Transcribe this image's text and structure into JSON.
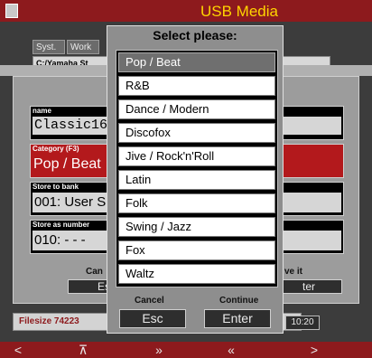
{
  "window": {
    "title": "USB Media"
  },
  "tabs": [
    "Syst.",
    "Work"
  ],
  "path": "C:/Yamaha St",
  "save_dialog": {
    "fields": {
      "name_label": "name",
      "name_value": "Classic16(",
      "category_label": "Category (F3)",
      "category_value": "Pop / Beat",
      "bank_label": "Store to bank",
      "bank_value": "001: User S",
      "number_label": "Store as number",
      "number_value": "010: - - -"
    },
    "cancel_caption": "Can",
    "cancel_button": "Es",
    "save_caption": "ve it",
    "save_button": "ter"
  },
  "status": {
    "filesize": "Filesize 74223",
    "time": "10:20"
  },
  "popup": {
    "title": "Select please:",
    "options": [
      "Pop / Beat",
      "R&B",
      "Dance / Modern",
      "Discofox",
      "Jive / Rock'n'Roll",
      "Latin",
      "Folk",
      "Swing / Jazz",
      "Fox",
      "Waltz"
    ],
    "selected_index": 0,
    "cancel_caption": "Cancel",
    "cancel_button": "Esc",
    "continue_caption": "Continue",
    "continue_button": "Enter"
  },
  "softkeys": [
    "˂",
    "⊼",
    "»",
    "«",
    "˃"
  ],
  "colors": {
    "accent_red": "#8d1a1d",
    "title_yellow": "#ffd400",
    "selected_grey": "#6f6f6f"
  }
}
